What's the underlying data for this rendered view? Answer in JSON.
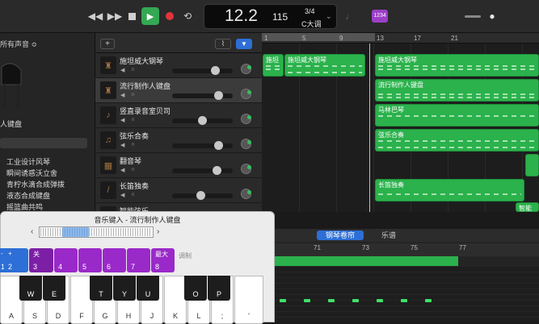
{
  "transport": {
    "position": "12.2",
    "tempo": "115",
    "signature": "3/4",
    "key": "C大调",
    "badge": "1234"
  },
  "library": {
    "header": "所有声音 ≎",
    "category": "人键盘",
    "patches": [
      "工业设计风琴",
      "瞬间诱惑沃立舍",
      "青柠水滴合成弹拨",
      "液态合成键盘",
      "摇篮曲共鸣"
    ]
  },
  "toolbar": {
    "add": "+"
  },
  "ruler": [
    "1",
    "5",
    "9",
    "13",
    "17",
    "21"
  ],
  "tracks": [
    {
      "name": "施坦威大钢琴",
      "icon": "♜"
    },
    {
      "name": "流行制作人键盘",
      "icon": "♜"
    },
    {
      "name": "竖直录音室贝司",
      "icon": "♪"
    },
    {
      "name": "弦乐合奏",
      "icon": "♫"
    },
    {
      "name": "翻音琴",
      "icon": "▦"
    },
    {
      "name": "长笛独奏",
      "icon": "/"
    },
    {
      "name": "智能弦乐",
      "icon": "♫"
    }
  ],
  "regions": [
    {
      "label": "施坦",
      "row": 0
    },
    {
      "label": "施坦威大钢琴",
      "row": 0
    },
    {
      "label": "施坦威大钢琴",
      "row": 0
    },
    {
      "label": "流行制作人键盘",
      "row": 1
    },
    {
      "label": "马林巴琴",
      "row": 2
    },
    {
      "label": "弦乐合奏",
      "row": 3
    },
    {
      "label": "",
      "row": 4
    },
    {
      "label": "长笛独奏",
      "row": 5
    },
    {
      "label": "智能",
      "row": 6
    }
  ],
  "editor": {
    "tab_piano": "钢琴卷帘",
    "tab_score": "乐谱",
    "ruler": [
      "71",
      "73",
      "75",
      "77"
    ]
  },
  "musical_typing": {
    "title": "音乐键入 - 流行制作人键盘",
    "octave_keys": [
      {
        "top": "-",
        "bot": "1"
      },
      {
        "top": "+",
        "bot": "2"
      }
    ],
    "velocity_keys": [
      {
        "top": "关",
        "bot": "3"
      },
      {
        "top": "",
        "bot": "4"
      },
      {
        "top": "",
        "bot": "5"
      },
      {
        "top": "",
        "bot": "6"
      },
      {
        "top": "",
        "bot": "7"
      },
      {
        "top": "最大",
        "bot": "8"
      }
    ],
    "velocity_label": "调制",
    "black_keys": [
      "W",
      "E",
      "T",
      "Y",
      "U",
      "O",
      "P"
    ],
    "white_keys": [
      "A",
      "S",
      "D",
      "F",
      "G",
      "H",
      "J",
      "K",
      "L",
      ";",
      "'"
    ]
  }
}
